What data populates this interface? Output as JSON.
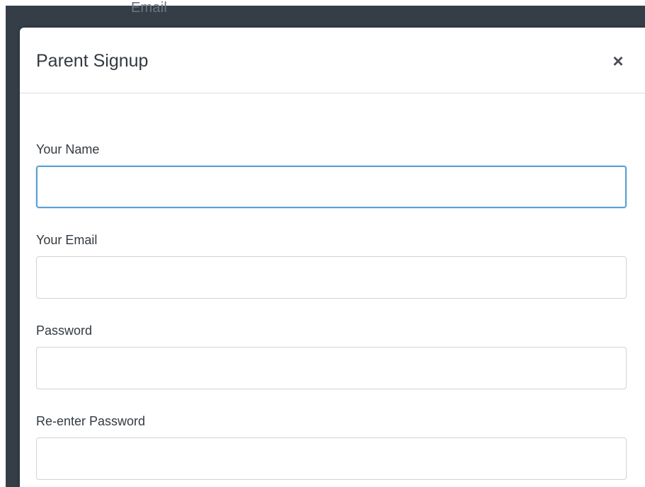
{
  "background": {
    "email_label": "Email"
  },
  "modal": {
    "title": "Parent Signup",
    "close_label": "×",
    "fields": [
      {
        "label": "Your Name",
        "value": "",
        "placeholder": ""
      },
      {
        "label": "Your Email",
        "value": "",
        "placeholder": ""
      },
      {
        "label": "Password",
        "value": "",
        "placeholder": ""
      },
      {
        "label": "Re-enter Password",
        "value": "",
        "placeholder": ""
      }
    ]
  },
  "colors": {
    "backdrop": "#353e47",
    "focus_border": "#5a9fd4",
    "input_border": "#cfd4d9",
    "text": "#333a40"
  }
}
